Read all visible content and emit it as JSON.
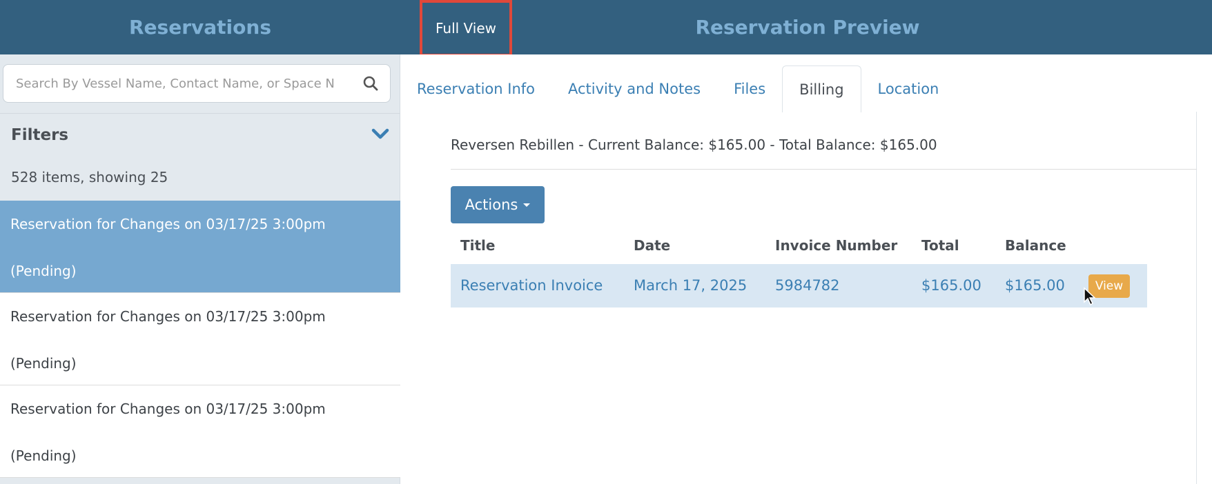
{
  "header": {
    "left_title": "Reservations",
    "full_view_label": "Full View",
    "right_title": "Reservation Preview"
  },
  "sidebar": {
    "search_placeholder": "Search By Vessel Name, Contact Name, or Space N",
    "filters_label": "Filters",
    "count_text": "528 items, showing 25",
    "items": [
      {
        "line1": "Reservation for Changes on 03/17/25 3:00pm",
        "line2": "(Pending)",
        "active": true
      },
      {
        "line1": "Reservation for Changes on 03/17/25 3:00pm",
        "line2": "(Pending)",
        "active": false
      },
      {
        "line1": "Reservation for Changes on 03/17/25 3:00pm",
        "line2": "(Pending)",
        "active": false
      }
    ]
  },
  "tabs": [
    {
      "label": "Reservation Info"
    },
    {
      "label": "Activity and Notes"
    },
    {
      "label": "Files"
    },
    {
      "label": "Billing",
      "active": true
    },
    {
      "label": "Location"
    }
  ],
  "billing": {
    "balance_text": "Reversen Rebillen - Current Balance: $165.00 - Total Balance: $165.00",
    "actions_label": "Actions",
    "columns": [
      "Title",
      "Date",
      "Invoice Number",
      "Total",
      "Balance"
    ],
    "rows": [
      {
        "title": "Reservation Invoice",
        "date": "March 17, 2025",
        "invoice_number": "5984782",
        "total": "$165.00",
        "balance": "$165.00",
        "action_label": "View"
      }
    ]
  },
  "colors": {
    "header_bg": "#33607f",
    "accent_blue": "#4a82b0",
    "link_blue": "#3b7fb3",
    "active_item_bg": "#76a8d0",
    "view_button": "#e8a94a",
    "highlight_border": "#e0483a"
  }
}
